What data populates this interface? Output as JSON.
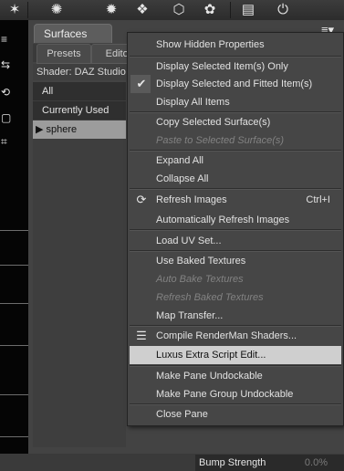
{
  "toolbar": {
    "icons": [
      "sparkle-icon",
      "cogwheel-icon",
      "bulb-icon",
      "cubes-icon",
      "cube-wireframe-icon",
      "paint-splash-icon",
      "window-panel-icon",
      "power-icon"
    ]
  },
  "viewport": {
    "side_glyphs": [
      "⇆",
      "⟲",
      "▢",
      "⌗"
    ]
  },
  "pane": {
    "title": "Surfaces",
    "tabs": [
      "Presets",
      "Editor"
    ],
    "shader_label": "Shader: DAZ Studio",
    "tree": [
      "All",
      "Currently Used",
      "sphere"
    ],
    "tree_expander": "▶",
    "bottom_row": {
      "label": "Bump Strength",
      "value": "0.0%"
    }
  },
  "menu": {
    "items": {
      "show_hidden": "Show Hidden Properties",
      "display_selected_only": "Display Selected Item(s) Only",
      "display_selected_fitted": "Display Selected and Fitted Item(s)",
      "display_all": "Display All Items",
      "copy_selected": "Copy Selected Surface(s)",
      "paste_selected": "Paste to Selected Surface(s)",
      "expand_all": "Expand All",
      "collapse_all": "Collapse All",
      "refresh_images": "Refresh Images",
      "refresh_shortcut": "Ctrl+I",
      "auto_refresh": "Automatically Refresh Images",
      "load_uv": "Load UV Set...",
      "use_baked": "Use Baked Textures",
      "auto_bake": "Auto Bake Textures",
      "refresh_baked": "Refresh Baked Textures",
      "map_transfer": "Map Transfer...",
      "compile_renderman": "Compile RenderMan Shaders...",
      "luxus_extra": "Luxus Extra Script Edit...",
      "pane_undockable": "Make Pane Undockable",
      "group_undockable": "Make Pane Group Undockable",
      "close_pane": "Close Pane"
    }
  }
}
